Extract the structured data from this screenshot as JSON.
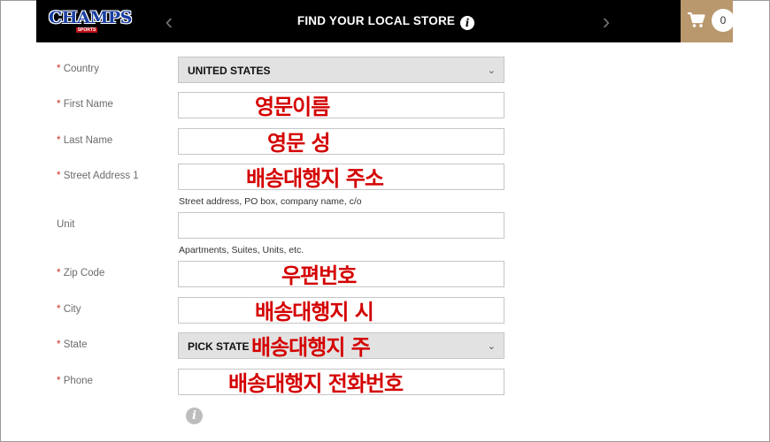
{
  "header": {
    "logo": "CHAMPS",
    "logo_sub": "SPORTS",
    "title": "FIND YOUR LOCAL STORE",
    "cart_count": "0"
  },
  "form": {
    "country": {
      "label": "Country",
      "value": "UNITED STATES"
    },
    "first_name": {
      "label": "First Name",
      "overlay": "영문이름"
    },
    "last_name": {
      "label": "Last Name",
      "overlay": "영문 성"
    },
    "street": {
      "label": "Street Address 1",
      "overlay": "배송대행지 주소",
      "hint": "Street address, PO box, company name, c/o"
    },
    "unit": {
      "label": "Unit",
      "hint": "Apartments, Suites, Units, etc."
    },
    "zip": {
      "label": "Zip Code",
      "overlay": "우편번호"
    },
    "city": {
      "label": "City",
      "overlay": "배송대행지 시"
    },
    "state": {
      "label": "State",
      "value": "PICK STATE",
      "overlay": "배송대행지 주"
    },
    "phone": {
      "label": "Phone",
      "overlay": "배송대행지 전화번호"
    },
    "required_marker": "*"
  },
  "icons": {
    "arrow_left": "chevron-left-icon",
    "arrow_right": "chevron-right-icon",
    "cart": "shopping-cart-icon",
    "info": "info-icon",
    "caret": "chevron-down-icon"
  },
  "colors": {
    "header_bg": "#000000",
    "cart_bg": "#b9986d",
    "overlay_text": "#d40000",
    "required": "#c8301f"
  }
}
